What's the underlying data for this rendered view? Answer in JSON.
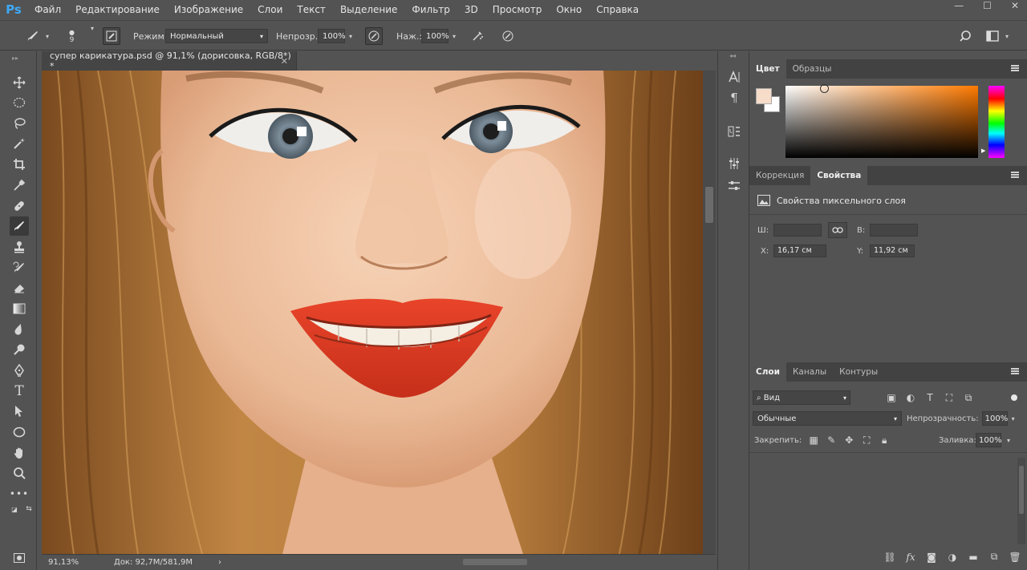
{
  "app": {
    "logo": "Ps"
  },
  "menu": [
    "Файл",
    "Редактирование",
    "Изображение",
    "Слои",
    "Текст",
    "Выделение",
    "Фильтр",
    "3D",
    "Просмотр",
    "Окно",
    "Справка"
  ],
  "window_controls": {
    "minimize": "—",
    "maximize": "☐",
    "close": "✕"
  },
  "options": {
    "brush_size": "9",
    "mode_label": "Режим:",
    "mode_value": "Нормальный",
    "opacity_label": "Непрозр.:",
    "opacity_value": "100%",
    "flow_label": "Наж.:",
    "flow_value": "100%"
  },
  "document": {
    "tab_title": "супер карикатура.psd @ 91,1% (дорисовка, RGB/8*) *",
    "close": "✕",
    "zoom": "91,13%",
    "doc_info": "Док: 92,7M/581,9M"
  },
  "colors": {
    "foreground": "#f7dcc9",
    "background": "#ffffff",
    "accent": "#ff7a00"
  },
  "color_panel": {
    "tabs": [
      "Цвет",
      "Образцы"
    ],
    "active_tab": "Цвет"
  },
  "properties_panel": {
    "tabs": [
      "Коррекция",
      "Свойства"
    ],
    "active_tab": "Свойства",
    "title": "Свойства пиксельного слоя",
    "w_label": "Ш:",
    "w_value": "",
    "h_label": "В:",
    "h_value": "",
    "x_label": "X:",
    "x_value": "16,17 см",
    "y_label": "Y:",
    "y_value": "11,92 см"
  },
  "layers_panel": {
    "tabs": [
      "Слои",
      "Каналы",
      "Контуры"
    ],
    "active_tab": "Слои",
    "filter_value": "Вид",
    "blend_mode": "Обычные",
    "opacity_label": "Непрозрачность:",
    "opacity_value": "100%",
    "lock_label": "Закрепить:",
    "fill_label": "Заливка:",
    "fill_value": "100%"
  },
  "icons": [
    "brush-icon",
    "move-icon",
    "marquee-icon",
    "lasso-icon",
    "magic-wand-icon",
    "crop-icon",
    "eyedropper-icon",
    "healing-icon",
    "brush-tool-icon",
    "stamp-icon",
    "history-brush-icon",
    "eraser-icon",
    "gradient-icon",
    "blur-icon",
    "dodge-icon",
    "pen-icon",
    "type-icon",
    "path-select-icon",
    "ellipse-icon",
    "hand-icon",
    "zoom-icon",
    "more-tools-icon",
    "search-icon",
    "workspace-icon",
    "link-icon",
    "fx-icon",
    "mask-icon",
    "adjustment-icon",
    "folder-icon",
    "new-layer-icon",
    "trash-icon"
  ]
}
